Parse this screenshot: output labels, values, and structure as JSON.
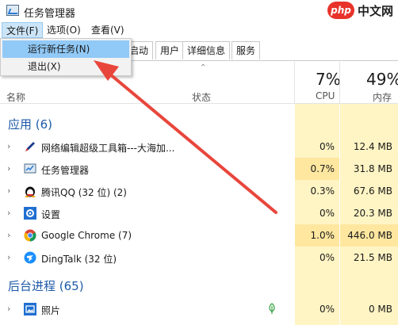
{
  "window": {
    "title": "任务管理器"
  },
  "watermark": {
    "logo": "php",
    "text": "中文网"
  },
  "menu": {
    "file": "文件(F)",
    "options": "选项(O)",
    "view": "查看(V)",
    "file_items": [
      "运行新任务(N)",
      "退出(X)"
    ]
  },
  "tabs": [
    "启动",
    "用户",
    "详细信息",
    "服务"
  ],
  "header": {
    "name": "名称",
    "status": "状态",
    "cpu_pct": "7%",
    "cpu": "CPU",
    "mem_pct": "49%",
    "mem": "内存"
  },
  "groups": {
    "apps": "应用 (6)",
    "background": "后台进程 (65)"
  },
  "rows": [
    {
      "name": "网络编辑超级工具箱---大海加...",
      "cpu": "0%",
      "mem": "12.4 MB",
      "icon": "pen-icon"
    },
    {
      "name": "任务管理器",
      "cpu": "0.7%",
      "mem": "31.8 MB",
      "icon": "task-manager-icon"
    },
    {
      "name": "腾讯QQ (32 位) (2)",
      "cpu": "0.3%",
      "mem": "67.6 MB",
      "icon": "qq-penguin-icon"
    },
    {
      "name": "设置",
      "cpu": "0%",
      "mem": "20.3 MB",
      "icon": "settings-gear-icon"
    },
    {
      "name": "Google Chrome (7)",
      "cpu": "1.0%",
      "mem": "446.0 MB",
      "icon": "chrome-icon"
    },
    {
      "name": "DingTalk (32 位)",
      "cpu": "0%",
      "mem": "21.5 MB",
      "icon": "dingtalk-icon"
    }
  ],
  "bg_rows": [
    {
      "name": "照片",
      "cpu": "0%",
      "mem": "0 MB",
      "icon": "photos-icon"
    }
  ],
  "colors": {
    "heat": "#fff4c4",
    "heat_hot": "#ffe7a0",
    "highlight": "#91c9f7",
    "group_text": "#1e5aa8",
    "arrow": "#e8463c"
  }
}
